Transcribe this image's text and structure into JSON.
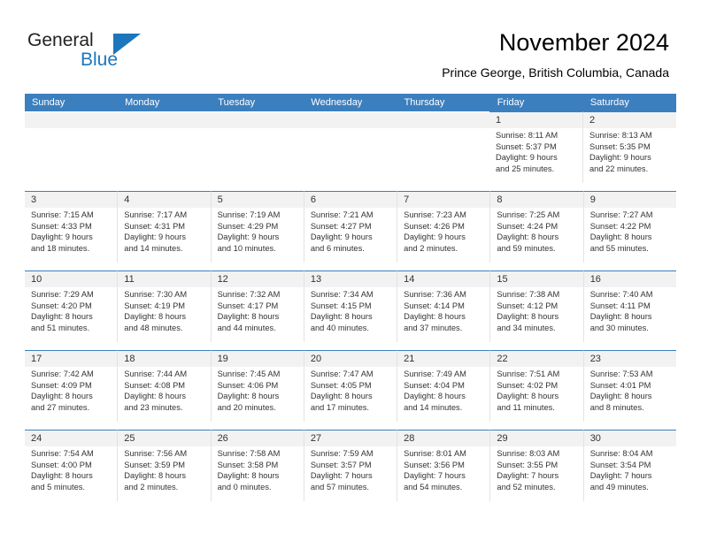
{
  "brand": {
    "name_part1": "General",
    "name_part2": "Blue",
    "logo_icon": "triangle-logo-icon",
    "accent_color": "#1b76bc"
  },
  "header": {
    "title": "November 2024",
    "subtitle": "Prince George, British Columbia, Canada"
  },
  "calendar": {
    "header_color": "#3c7fbf",
    "daynum_band_color": "#f2f2f2",
    "day_names": [
      "Sunday",
      "Monday",
      "Tuesday",
      "Wednesday",
      "Thursday",
      "Friday",
      "Saturday"
    ],
    "weeks": [
      [
        {
          "blank": true
        },
        {
          "blank": true
        },
        {
          "blank": true
        },
        {
          "blank": true
        },
        {
          "blank": true
        },
        {
          "day": "1",
          "sunrise": "Sunrise: 8:11 AM",
          "sunset": "Sunset: 5:37 PM",
          "daylight_line1": "Daylight: 9 hours",
          "daylight_line2": "and 25 minutes."
        },
        {
          "day": "2",
          "sunrise": "Sunrise: 8:13 AM",
          "sunset": "Sunset: 5:35 PM",
          "daylight_line1": "Daylight: 9 hours",
          "daylight_line2": "and 22 minutes."
        }
      ],
      [
        {
          "day": "3",
          "sunrise": "Sunrise: 7:15 AM",
          "sunset": "Sunset: 4:33 PM",
          "daylight_line1": "Daylight: 9 hours",
          "daylight_line2": "and 18 minutes."
        },
        {
          "day": "4",
          "sunrise": "Sunrise: 7:17 AM",
          "sunset": "Sunset: 4:31 PM",
          "daylight_line1": "Daylight: 9 hours",
          "daylight_line2": "and 14 minutes."
        },
        {
          "day": "5",
          "sunrise": "Sunrise: 7:19 AM",
          "sunset": "Sunset: 4:29 PM",
          "daylight_line1": "Daylight: 9 hours",
          "daylight_line2": "and 10 minutes."
        },
        {
          "day": "6",
          "sunrise": "Sunrise: 7:21 AM",
          "sunset": "Sunset: 4:27 PM",
          "daylight_line1": "Daylight: 9 hours",
          "daylight_line2": "and 6 minutes."
        },
        {
          "day": "7",
          "sunrise": "Sunrise: 7:23 AM",
          "sunset": "Sunset: 4:26 PM",
          "daylight_line1": "Daylight: 9 hours",
          "daylight_line2": "and 2 minutes."
        },
        {
          "day": "8",
          "sunrise": "Sunrise: 7:25 AM",
          "sunset": "Sunset: 4:24 PM",
          "daylight_line1": "Daylight: 8 hours",
          "daylight_line2": "and 59 minutes."
        },
        {
          "day": "9",
          "sunrise": "Sunrise: 7:27 AM",
          "sunset": "Sunset: 4:22 PM",
          "daylight_line1": "Daylight: 8 hours",
          "daylight_line2": "and 55 minutes."
        }
      ],
      [
        {
          "day": "10",
          "sunrise": "Sunrise: 7:29 AM",
          "sunset": "Sunset: 4:20 PM",
          "daylight_line1": "Daylight: 8 hours",
          "daylight_line2": "and 51 minutes."
        },
        {
          "day": "11",
          "sunrise": "Sunrise: 7:30 AM",
          "sunset": "Sunset: 4:19 PM",
          "daylight_line1": "Daylight: 8 hours",
          "daylight_line2": "and 48 minutes."
        },
        {
          "day": "12",
          "sunrise": "Sunrise: 7:32 AM",
          "sunset": "Sunset: 4:17 PM",
          "daylight_line1": "Daylight: 8 hours",
          "daylight_line2": "and 44 minutes."
        },
        {
          "day": "13",
          "sunrise": "Sunrise: 7:34 AM",
          "sunset": "Sunset: 4:15 PM",
          "daylight_line1": "Daylight: 8 hours",
          "daylight_line2": "and 40 minutes."
        },
        {
          "day": "14",
          "sunrise": "Sunrise: 7:36 AM",
          "sunset": "Sunset: 4:14 PM",
          "daylight_line1": "Daylight: 8 hours",
          "daylight_line2": "and 37 minutes."
        },
        {
          "day": "15",
          "sunrise": "Sunrise: 7:38 AM",
          "sunset": "Sunset: 4:12 PM",
          "daylight_line1": "Daylight: 8 hours",
          "daylight_line2": "and 34 minutes."
        },
        {
          "day": "16",
          "sunrise": "Sunrise: 7:40 AM",
          "sunset": "Sunset: 4:11 PM",
          "daylight_line1": "Daylight: 8 hours",
          "daylight_line2": "and 30 minutes."
        }
      ],
      [
        {
          "day": "17",
          "sunrise": "Sunrise: 7:42 AM",
          "sunset": "Sunset: 4:09 PM",
          "daylight_line1": "Daylight: 8 hours",
          "daylight_line2": "and 27 minutes."
        },
        {
          "day": "18",
          "sunrise": "Sunrise: 7:44 AM",
          "sunset": "Sunset: 4:08 PM",
          "daylight_line1": "Daylight: 8 hours",
          "daylight_line2": "and 23 minutes."
        },
        {
          "day": "19",
          "sunrise": "Sunrise: 7:45 AM",
          "sunset": "Sunset: 4:06 PM",
          "daylight_line1": "Daylight: 8 hours",
          "daylight_line2": "and 20 minutes."
        },
        {
          "day": "20",
          "sunrise": "Sunrise: 7:47 AM",
          "sunset": "Sunset: 4:05 PM",
          "daylight_line1": "Daylight: 8 hours",
          "daylight_line2": "and 17 minutes."
        },
        {
          "day": "21",
          "sunrise": "Sunrise: 7:49 AM",
          "sunset": "Sunset: 4:04 PM",
          "daylight_line1": "Daylight: 8 hours",
          "daylight_line2": "and 14 minutes."
        },
        {
          "day": "22",
          "sunrise": "Sunrise: 7:51 AM",
          "sunset": "Sunset: 4:02 PM",
          "daylight_line1": "Daylight: 8 hours",
          "daylight_line2": "and 11 minutes."
        },
        {
          "day": "23",
          "sunrise": "Sunrise: 7:53 AM",
          "sunset": "Sunset: 4:01 PM",
          "daylight_line1": "Daylight: 8 hours",
          "daylight_line2": "and 8 minutes."
        }
      ],
      [
        {
          "day": "24",
          "sunrise": "Sunrise: 7:54 AM",
          "sunset": "Sunset: 4:00 PM",
          "daylight_line1": "Daylight: 8 hours",
          "daylight_line2": "and 5 minutes."
        },
        {
          "day": "25",
          "sunrise": "Sunrise: 7:56 AM",
          "sunset": "Sunset: 3:59 PM",
          "daylight_line1": "Daylight: 8 hours",
          "daylight_line2": "and 2 minutes."
        },
        {
          "day": "26",
          "sunrise": "Sunrise: 7:58 AM",
          "sunset": "Sunset: 3:58 PM",
          "daylight_line1": "Daylight: 8 hours",
          "daylight_line2": "and 0 minutes."
        },
        {
          "day": "27",
          "sunrise": "Sunrise: 7:59 AM",
          "sunset": "Sunset: 3:57 PM",
          "daylight_line1": "Daylight: 7 hours",
          "daylight_line2": "and 57 minutes."
        },
        {
          "day": "28",
          "sunrise": "Sunrise: 8:01 AM",
          "sunset": "Sunset: 3:56 PM",
          "daylight_line1": "Daylight: 7 hours",
          "daylight_line2": "and 54 minutes."
        },
        {
          "day": "29",
          "sunrise": "Sunrise: 8:03 AM",
          "sunset": "Sunset: 3:55 PM",
          "daylight_line1": "Daylight: 7 hours",
          "daylight_line2": "and 52 minutes."
        },
        {
          "day": "30",
          "sunrise": "Sunrise: 8:04 AM",
          "sunset": "Sunset: 3:54 PM",
          "daylight_line1": "Daylight: 7 hours",
          "daylight_line2": "and 49 minutes."
        }
      ]
    ]
  }
}
